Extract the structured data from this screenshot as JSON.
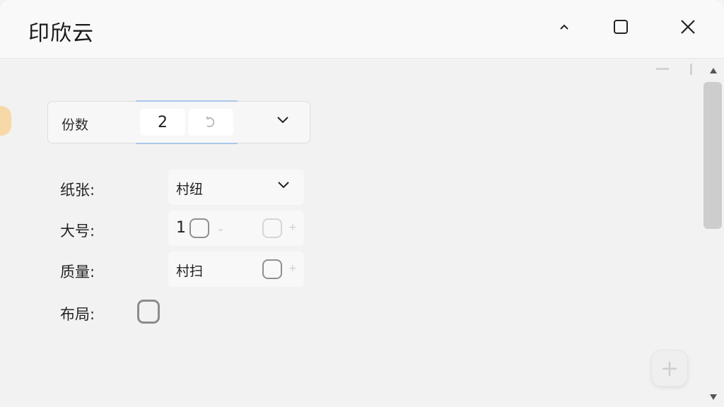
{
  "window": {
    "title": "印欣云",
    "controls": {
      "collapse_icon": "chevron-up-icon",
      "maximize_icon": "maximize-icon",
      "close_icon": "close-icon"
    }
  },
  "form": {
    "copies": {
      "label": "份数",
      "value": "2",
      "refresh_icon": "refresh-icon",
      "dropdown_icon": "chevron-down-icon"
    },
    "paper": {
      "label": "纸张:",
      "value": "村纽",
      "dropdown_icon": "chevron-down-icon"
    },
    "size": {
      "label": "大号:",
      "prefix": "1"
    },
    "quality": {
      "label": "质量:",
      "value": "村扫"
    },
    "layout": {
      "label": "布局:"
    }
  },
  "fab": {
    "icon": "plus-icon",
    "label": "+"
  },
  "colors": {
    "title_bg": "#f9f9f9",
    "focus_accent": "#a9c8ea",
    "left_tab": "#f7d9a8",
    "scroll_thumb": "#cdcdcd"
  }
}
